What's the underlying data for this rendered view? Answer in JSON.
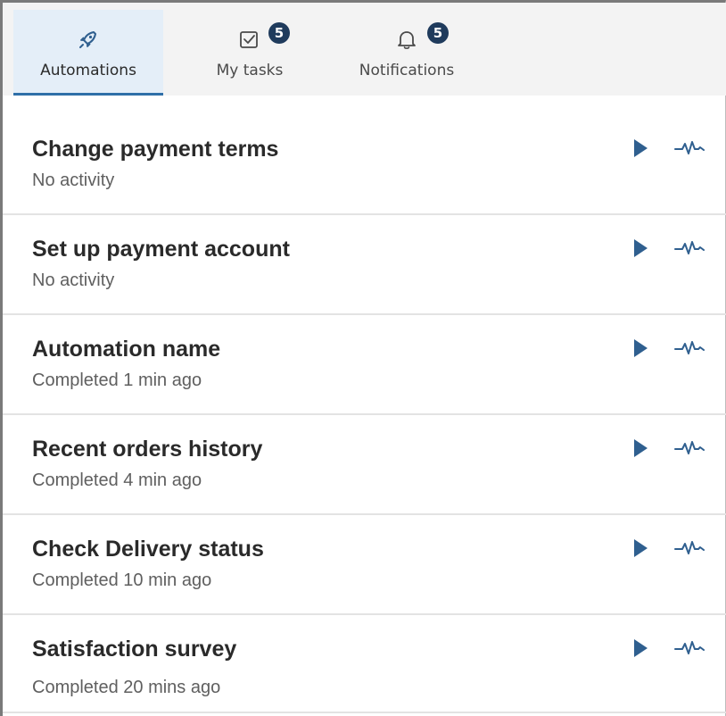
{
  "tabs": [
    {
      "label": "Automations",
      "icon": "rocket-icon",
      "active": true
    },
    {
      "label": "My tasks",
      "icon": "checkbox-icon",
      "badge": "5"
    },
    {
      "label": "Notifications",
      "icon": "bell-icon",
      "badge": "5"
    }
  ],
  "automations": [
    {
      "title": "Change payment terms",
      "status": "No activity"
    },
    {
      "title": "Set up payment account",
      "status": "No activity"
    },
    {
      "title": "Automation name",
      "status": "Completed 1 min ago"
    },
    {
      "title": "Recent orders history",
      "status": "Completed 4 min ago"
    },
    {
      "title": "Check Delivery status",
      "status": "Completed 10 min ago"
    },
    {
      "title": "Satisfaction survey",
      "status": "Completed 20 mins ago"
    }
  ],
  "row_icons": {
    "run": "play-icon",
    "activity": "activity-pulse-icon"
  },
  "colors": {
    "accent": "#2f6fa8",
    "badge": "#1f3b5c",
    "icon": "#2f5f8f"
  }
}
